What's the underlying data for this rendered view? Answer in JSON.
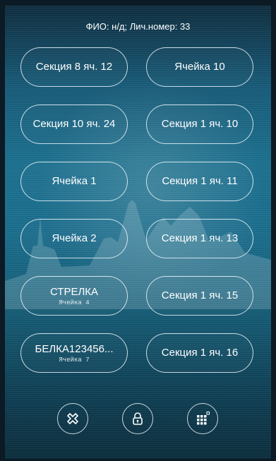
{
  "header": {
    "text": "ФИО: н/д; Лич.номер: 33"
  },
  "cells": [
    {
      "label": "Секция 8 яч. 12",
      "sub": ""
    },
    {
      "label": "Ячейка 10",
      "sub": ""
    },
    {
      "label": "Секция 10 яч. 24",
      "sub": ""
    },
    {
      "label": "Секция 1 яч. 10",
      "sub": ""
    },
    {
      "label": "Ячейка 1",
      "sub": ""
    },
    {
      "label": "Секция 1 яч. 11",
      "sub": ""
    },
    {
      "label": "Ячейка 2",
      "sub": ""
    },
    {
      "label": "Секция 1 яч. 13",
      "sub": ""
    },
    {
      "label": "СТРЕЛКА",
      "sub": "Ячейка 4"
    },
    {
      "label": "Секция 1 яч. 15",
      "sub": ""
    },
    {
      "label": "БЕЛКА123456...",
      "sub": "Ячейка 7"
    },
    {
      "label": "Секция 1 яч. 16",
      "sub": ""
    }
  ],
  "bottom_bar": {
    "icons": [
      "close-icon",
      "lock-icon",
      "keypad-icon"
    ]
  },
  "colors": {
    "accent": "#ffffff",
    "background_top": "#0f2d3f",
    "background_mid": "#1b6f8d"
  }
}
